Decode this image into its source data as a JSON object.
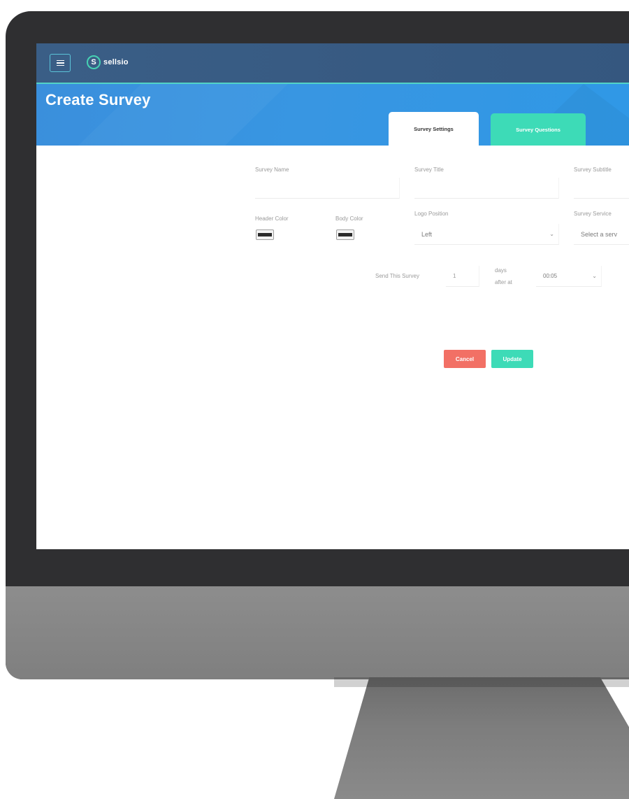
{
  "app": {
    "brand": "sellsio",
    "brand_mark": "S",
    "menu_icon": "hamburger-menu-icon"
  },
  "page": {
    "title": "Create Survey"
  },
  "tabs": [
    {
      "label": "Survey Settings",
      "active": true
    },
    {
      "label": "Survey Questions",
      "active": false
    }
  ],
  "form": {
    "survey_name_label": "Survey Name",
    "survey_name_value": "",
    "survey_title_label": "Survey Title",
    "survey_title_value": "",
    "survey_subtitle_label": "Survey Subtitle",
    "survey_subtitle_value": "",
    "header_color_label": "Header Color",
    "header_color": "#2b2b2b",
    "body_color_label": "Body Color",
    "body_color": "#2b2b2b",
    "logo_position_label": "Logo Position",
    "logo_position_value": "Left",
    "survey_service_label": "Survey Service",
    "survey_service_value": "Select a serv"
  },
  "schedule": {
    "send_label": "Send This Survey",
    "days_value": "1",
    "days_after_line1": "days",
    "days_after_line2": "after at",
    "time_value": "00:05"
  },
  "actions": {
    "cancel_label": "Cancel",
    "update_label": "Update"
  },
  "colors": {
    "nav": "#37597f",
    "banner": "#3893e0",
    "accent": "#3ddbb7",
    "cancel": "#f27065"
  }
}
